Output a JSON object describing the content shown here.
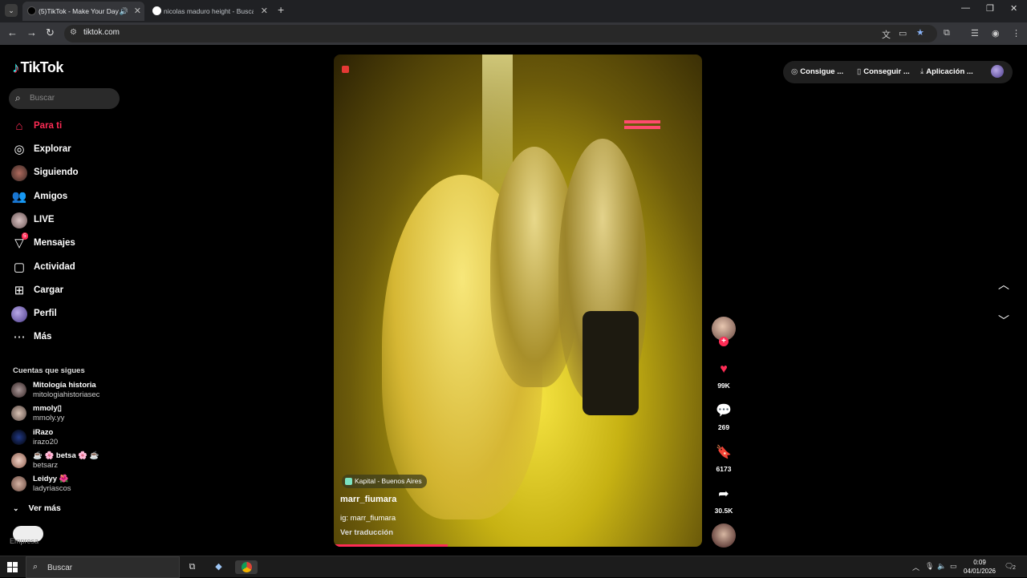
{
  "browser": {
    "tabs": [
      {
        "title": "(5)TikTok - Make Your Day",
        "active": true
      },
      {
        "title": "nicolas maduro height - Buscar",
        "active": false
      }
    ],
    "url": "tiktok.com"
  },
  "sidebar": {
    "logo": "TikTok",
    "search_placeholder": "Buscar",
    "nav": [
      {
        "label": "Para ti",
        "icon": "home-icon"
      },
      {
        "label": "Explorar",
        "icon": "compass-icon"
      },
      {
        "label": "Siguiendo",
        "icon": "following-avatar-icon"
      },
      {
        "label": "Amigos",
        "icon": "friends-icon"
      },
      {
        "label": "LIVE",
        "icon": "live-icon"
      },
      {
        "label": "Mensajes",
        "icon": "messages-icon",
        "badge": "5"
      },
      {
        "label": "Actividad",
        "icon": "activity-icon"
      },
      {
        "label": "Cargar",
        "icon": "upload-icon"
      },
      {
        "label": "Perfil",
        "icon": "profile-avatar-icon"
      },
      {
        "label": "Más",
        "icon": "more-icon"
      }
    ],
    "following_title": "Cuentas que sigues",
    "following": [
      {
        "name": "Mitología historia",
        "handle": "mitologiahistoriasec"
      },
      {
        "name": "mmoly▯",
        "handle": "mmoly.yy"
      },
      {
        "name": "iRazo",
        "handle": "irazo20"
      },
      {
        "name": "☕ 🌸 betsa 🌸 ☕",
        "handle": "betsarz"
      },
      {
        "name": "Leidyy 🌺",
        "handle": "ladyriascos"
      }
    ],
    "see_more": "Ver más",
    "footer": "Empresa"
  },
  "video": {
    "location": "Kapital - Buenos Aires",
    "author": "marr_fiumara",
    "caption": "ig: marr_fiumara",
    "translate": "Ver traducción",
    "progress": 0.31
  },
  "actions": {
    "likes": "99K",
    "comments": "269",
    "saves": "6173",
    "shares": "30.5K"
  },
  "top_right": {
    "pill1": "Consigue ...",
    "pill2": "Conseguir ...",
    "pill3": "Aplicación ..."
  },
  "taskbar": {
    "search": "Buscar",
    "time": "0:09",
    "date": "04/01/2026",
    "notifications": "2"
  },
  "colors": {
    "accent": "#fe2c55",
    "background": "#000000"
  }
}
